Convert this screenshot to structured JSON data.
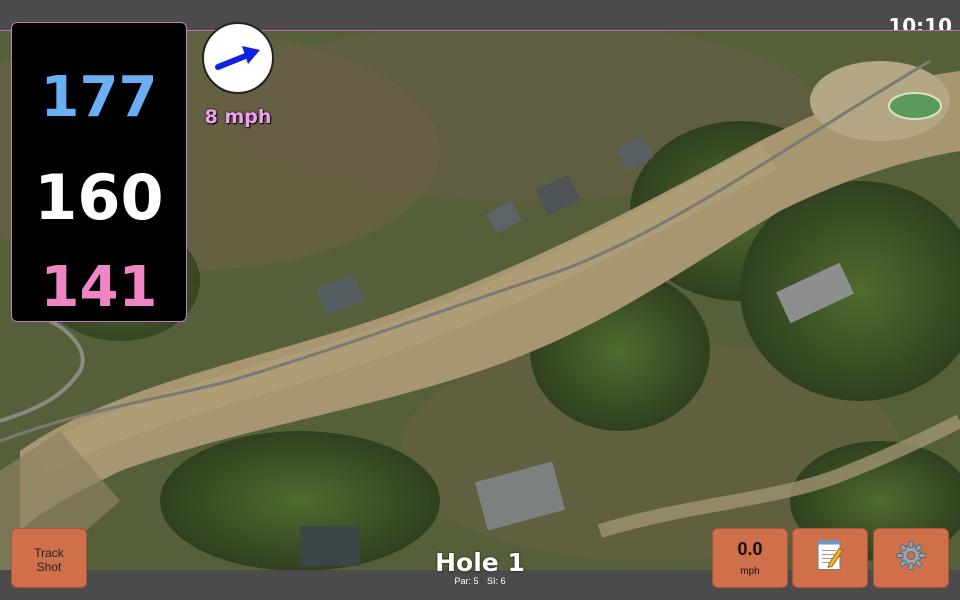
{
  "status_bar": {
    "time": "10:10"
  },
  "distances": {
    "back": "177",
    "middle": "160",
    "front": "141"
  },
  "wind": {
    "speed": "8 mph",
    "icon": "wind-arrow-icon"
  },
  "buttons": {
    "track_shot": "Track\nShot",
    "speed_value": "0.0",
    "speed_unit": "mph",
    "notes_icon": "notepad-icon",
    "settings_icon": "gear-icon"
  },
  "hole": {
    "title": "Hole 1",
    "par": "Par: 5",
    "si": "SI: 6"
  },
  "colors": {
    "back_distance": "#6aaef5",
    "middle_distance": "#ffffff",
    "front_distance": "#f085c6",
    "wind_text": "#f0a0f0",
    "button_bg": "#d0704a",
    "bars": "#4b4b4b"
  }
}
